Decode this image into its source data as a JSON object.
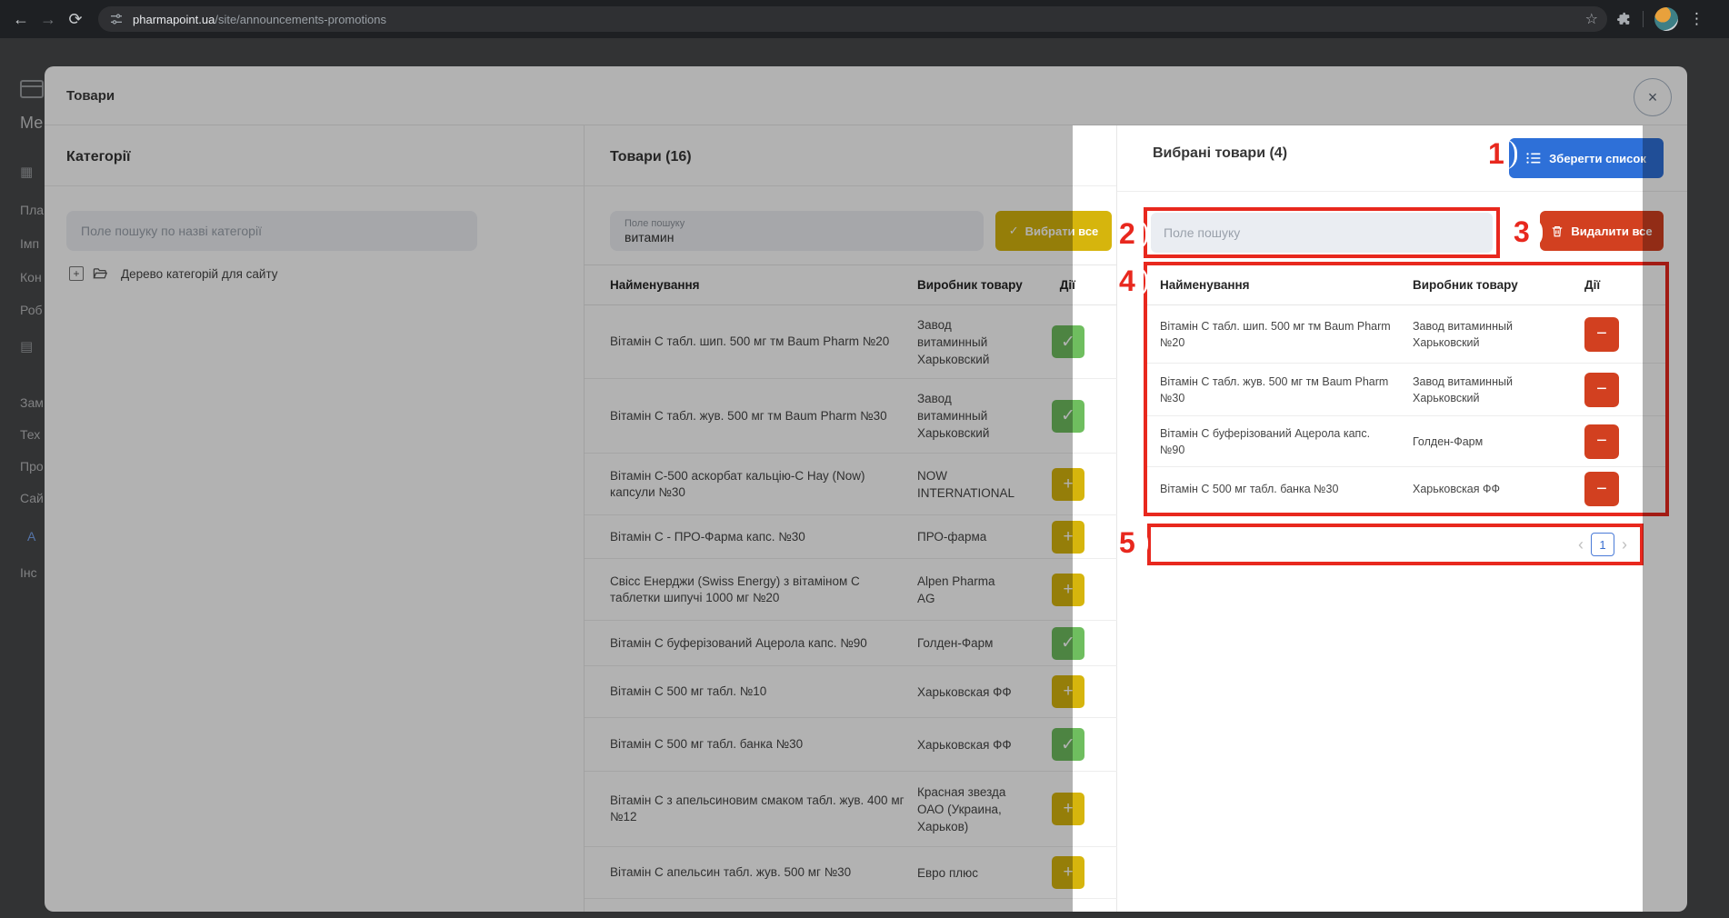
{
  "browser": {
    "url_domain": "pharmapoint.ua",
    "url_path": "/site/announcements-promotions",
    "bookmark_star": "☆",
    "menu_dots": "⋮"
  },
  "sidebar": {
    "items": [
      "Ме",
      "Пла",
      "Імп",
      "Кон",
      "Роб",
      "Зам",
      "Тех",
      "Про",
      "Сай",
      "А",
      "Інс"
    ]
  },
  "modal": {
    "title": "Товари",
    "close_icon": "×"
  },
  "categories": {
    "title": "Категорії",
    "search_placeholder": "Поле пошуку по назві категорії",
    "expander": "+",
    "tree_item": "Дерево категорій для сайту"
  },
  "products": {
    "title": "Товари (16)",
    "search_label": "Поле пошуку",
    "search_value": "витамин",
    "select_all_label": "Вибрати все",
    "check_glyph": "✓",
    "headers": [
      "Найменування",
      "Виробник товару",
      "Дії"
    ],
    "action_icons": {
      "added": "✓",
      "add": "+"
    },
    "rows": [
      {
        "name": "Вітамін C табл. шип. 500 мг тм Baum Pharm №20",
        "manufacturer": "Завод витаминный Харьковский",
        "action": "added"
      },
      {
        "name": "Вітамін C табл. жув. 500 мг тм Baum Pharm №30",
        "manufacturer": "Завод витаминный Харьковский",
        "action": "added"
      },
      {
        "name": "Вітамін C-500 аскорбат кальцію-C Нау (Now) капсули №30",
        "manufacturer": "NOW INTERNATIONAL",
        "action": "add"
      },
      {
        "name": "Вітамін C - ПРО-Фарма капс. №30",
        "manufacturer": "ПРО-фарма",
        "action": "add"
      },
      {
        "name": "Свісс Енерджи (Swiss Energy) з вітаміном C таблетки шипучі 1000 мг №20",
        "manufacturer": "Alpen Pharma AG",
        "action": "add"
      },
      {
        "name": "Вітамін C буферізований Ацерола капс. №90",
        "manufacturer": "Голден-Фарм",
        "action": "added"
      },
      {
        "name": "Вітамін C 500 мг табл. №10",
        "manufacturer": "Харьковская ФФ",
        "action": "add"
      },
      {
        "name": "Вітамін C 500 мг табл. банка №30",
        "manufacturer": "Харьковская ФФ",
        "action": "added"
      },
      {
        "name": "Вітамін C з апельсиновим смаком табл. жув. 400 мг №12",
        "manufacturer": "Красная звезда ОАО (Украина, Харьков)",
        "action": "add"
      },
      {
        "name": "Вітамін C апельсин табл. жув. 500 мг №30",
        "manufacturer": "Евро плюс",
        "action": "add"
      }
    ]
  },
  "selected": {
    "title": "Вибрані товари (4)",
    "save_button_label": "Зберегти список",
    "search_placeholder": "Поле пошуку",
    "delete_all_label": "Видалити все",
    "headers": [
      "Найменування",
      "Виробник товару",
      "Дії"
    ],
    "remove_icon": "−",
    "rows": [
      {
        "name": "Вітамін C табл. шип. 500 мг тм Baum Pharm №20",
        "manufacturer": "Завод витаминный Харьковский"
      },
      {
        "name": "Вітамін C табл. жув. 500 мг тм Baum Pharm №30",
        "manufacturer": "Завод витаминный Харьковский"
      },
      {
        "name": "Вітамін C буферізований Ацерола капс. №90",
        "manufacturer": "Голден-Фарм"
      },
      {
        "name": "Вітамін C 500 мг табл. банка №30",
        "manufacturer": "Харьковская ФФ"
      }
    ],
    "pagination": {
      "prev": "‹",
      "page": "1",
      "next": "›"
    }
  },
  "annotations": {
    "markers": [
      "1",
      "2",
      "3",
      "4",
      "5"
    ],
    "color": "#e8281e"
  },
  "colors": {
    "primary_blue": "#2e70d8",
    "danger_red": "#d24020",
    "warning_gold": "#d6b50d",
    "success_green": "#6fbe5f",
    "annotation_red": "#e8281e"
  }
}
